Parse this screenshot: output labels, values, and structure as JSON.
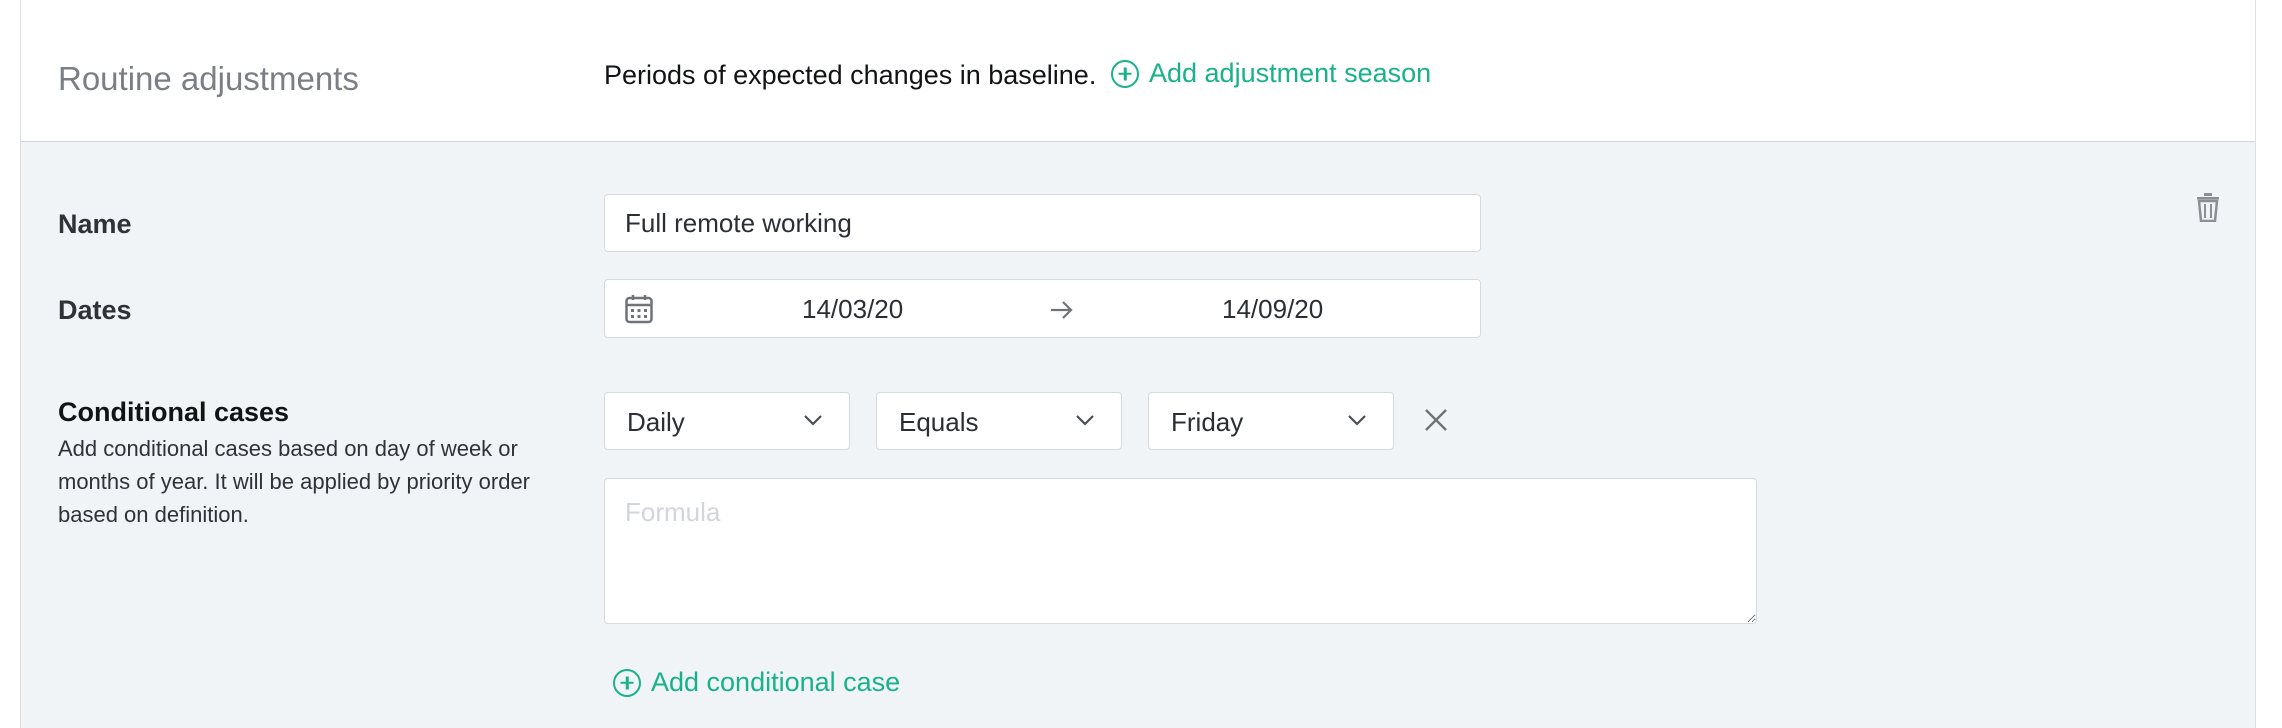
{
  "section": {
    "title": "Routine adjustments",
    "description": "Periods of expected changes in baseline.",
    "add_label": "Add adjustment season"
  },
  "season": {
    "name_label": "Name",
    "name_value": "Full remote working",
    "dates_label": "Dates",
    "start_date": "14/03/20",
    "end_date": "14/09/20",
    "conditional_title": "Conditional cases",
    "conditional_desc": "Add conditional cases based on day of week or months of year. It will be applied by priority order based on definition.",
    "selects": {
      "period": "Daily",
      "operator": "Equals",
      "value": "Friday"
    },
    "formula_placeholder": "Formula",
    "add_case_label": "Add conditional case"
  },
  "colors": {
    "accent": "#18b28a",
    "panel_bg": "#f1f4f7"
  },
  "icons": [
    "plus-circle-icon",
    "calendar-icon",
    "arrow-right-icon",
    "trash-icon",
    "chevron-down-icon",
    "close-icon"
  ]
}
